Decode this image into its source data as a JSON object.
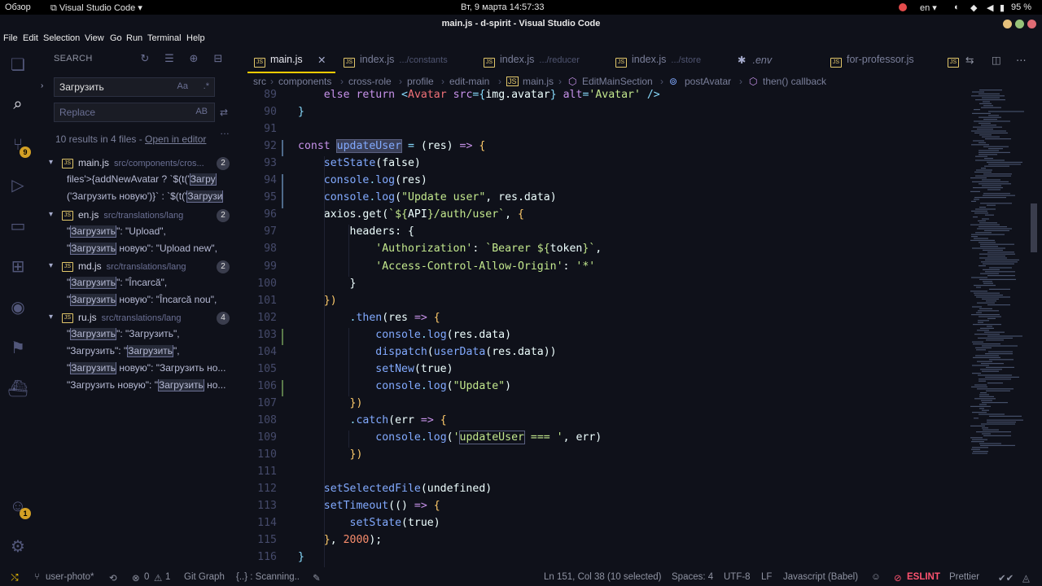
{
  "topbar": {
    "overview": "Обзор",
    "app": "Visual Studio Code",
    "datetime": "Вт, 9 марта  14:57:33",
    "lang": "en",
    "battery": "95 %"
  },
  "window": {
    "title": "main.js - d-spirit - Visual Studio Code"
  },
  "menu": [
    "File",
    "Edit",
    "Selection",
    "View",
    "Go",
    "Run",
    "Terminal",
    "Help"
  ],
  "activity": {
    "scm_badge": "9",
    "accounts_badge": "1"
  },
  "search": {
    "title": "SEARCH",
    "query": "Загрузить",
    "replace_placeholder": "Replace",
    "aa": "Aa",
    "ab": "AB",
    "results": "10 results in 4 files - ",
    "open_editor": "Open in editor",
    "groups": [
      {
        "file": "main.js",
        "path": "src/components/cros...",
        "count": "2",
        "matches": [
          [
            "files'>{addNewAvatar ? `$(t('",
            "Загру",
            ""
          ],
          [
            "('Загрузить новую')}` : `$(t('",
            "Загрузи",
            ""
          ]
        ]
      },
      {
        "file": "en.js",
        "path": "src/translations/lang",
        "count": "2",
        "matches": [
          [
            "\"",
            "Загрузить",
            "\": \"Upload\","
          ],
          [
            "\"",
            "Загрузить",
            " новую\": \"Upload new\","
          ]
        ]
      },
      {
        "file": "md.js",
        "path": "src/translations/lang",
        "count": "2",
        "matches": [
          [
            "\"",
            "Загрузить",
            "\": \"Încarcă\","
          ],
          [
            "\"",
            "Загрузить",
            " новую\": \"Încarcă nou\","
          ]
        ]
      },
      {
        "file": "ru.js",
        "path": "src/translations/lang",
        "count": "4",
        "matches": [
          [
            "\"",
            "Загрузить",
            "\": \"Загрузить\","
          ],
          [
            "\"Загрузить\": \"",
            "Загрузить",
            "\","
          ],
          [
            "\"",
            "Загрузить",
            " новую\": \"Загрузить но..."
          ],
          [
            "\"Загрузить новую\": \"",
            "Загрузить",
            " но..."
          ]
        ]
      }
    ]
  },
  "tabs": [
    {
      "name": "main.js",
      "dir": "",
      "active": true
    },
    {
      "name": "index.js",
      "dir": ".../constants"
    },
    {
      "name": "index.js",
      "dir": ".../reducer"
    },
    {
      "name": "index.js",
      "dir": ".../store"
    },
    {
      "name": ".env",
      "dir": ""
    },
    {
      "name": "for-professor.js",
      "dir": ""
    }
  ],
  "breadcrumb": [
    "src",
    "components",
    "cross-role",
    "profile",
    "edit-main",
    "main.js",
    "EditMainSection",
    "postAvatar",
    "then() callback"
  ],
  "code_start": 89,
  "status": {
    "branch": "user-photo*",
    "problems": "0",
    "warnings": "1",
    "git": "Git Graph",
    "scanning": "{..} : Scanning..",
    "position": "Ln 151, Col 38 (10 selected)",
    "spaces": "Spaces: 4",
    "encoding": "UTF-8",
    "eol": "LF",
    "language": "Javascript (Babel)",
    "eslint": "ESLINT",
    "prettier": "Prettier"
  }
}
